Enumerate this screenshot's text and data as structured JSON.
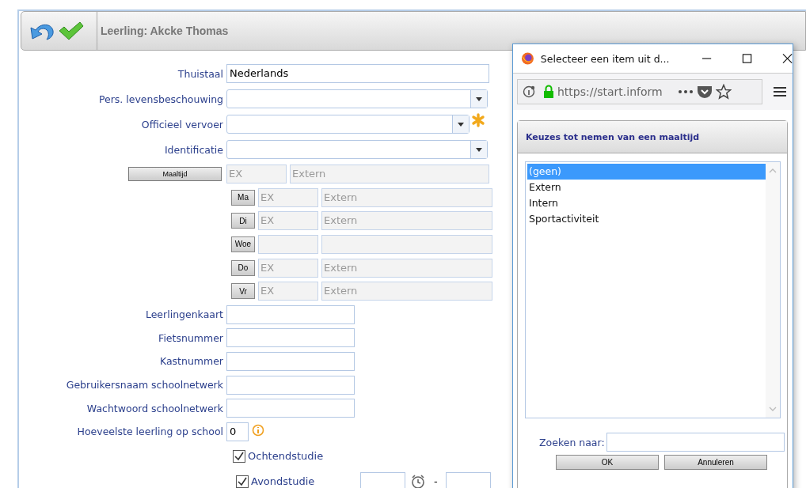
{
  "header": {
    "title": "Leerling: Akcke Thomas"
  },
  "fields_top": [
    {
      "label": "Thuistaal",
      "kind": "input",
      "value": "Nederlands"
    },
    {
      "label": "Pers. levensbeschouwing",
      "kind": "select",
      "required": false
    },
    {
      "label": "Officieel vervoer",
      "kind": "select",
      "required": true
    },
    {
      "label": "Identificatie",
      "kind": "select",
      "required": false
    }
  ],
  "meal": {
    "button": "Maaltijd",
    "code": "EX",
    "label": "Extern",
    "days": [
      {
        "button": "Ma",
        "code": "EX",
        "label": "Extern"
      },
      {
        "button": "Di",
        "code": "EX",
        "label": "Extern"
      },
      {
        "button": "Woe"
      },
      {
        "button": "Do",
        "code": "EX",
        "label": "Extern"
      },
      {
        "button": "Vr",
        "code": "EX",
        "label": "Extern"
      }
    ]
  },
  "fields_bottom": [
    {
      "label": "Leerlingenkaart",
      "kind": "field"
    },
    {
      "label": "Fietsnummer",
      "kind": "field"
    },
    {
      "label": "Kastnummer",
      "kind": "field"
    },
    {
      "label": "Gebruikersnaam schoolnetwerk",
      "kind": "field"
    },
    {
      "label": "Wachtwoord schoolnetwerk",
      "kind": "field"
    },
    {
      "label": "Hoeveelste leerling op school",
      "kind": "counter",
      "value": "0"
    }
  ],
  "checks": [
    {
      "label": "Ochtendstudie",
      "checked": true,
      "kind": "plain"
    },
    {
      "label": "Avondstudie",
      "checked": true,
      "kind": "timed",
      "separator": "-"
    }
  ],
  "popup": {
    "title": "Selecteer een item uit d...",
    "url": "https://start.inform",
    "header": "Keuzes tot nemen van een maaltijd",
    "items": [
      {
        "label": "(geen)",
        "selected": true
      },
      {
        "label": "Extern",
        "selected": false
      },
      {
        "label": "Intern",
        "selected": false
      },
      {
        "label": "Sportactiviteit",
        "selected": false
      }
    ],
    "search_label": "Zoeken naar:",
    "buttons": [
      "OK",
      "Annuleren"
    ]
  }
}
